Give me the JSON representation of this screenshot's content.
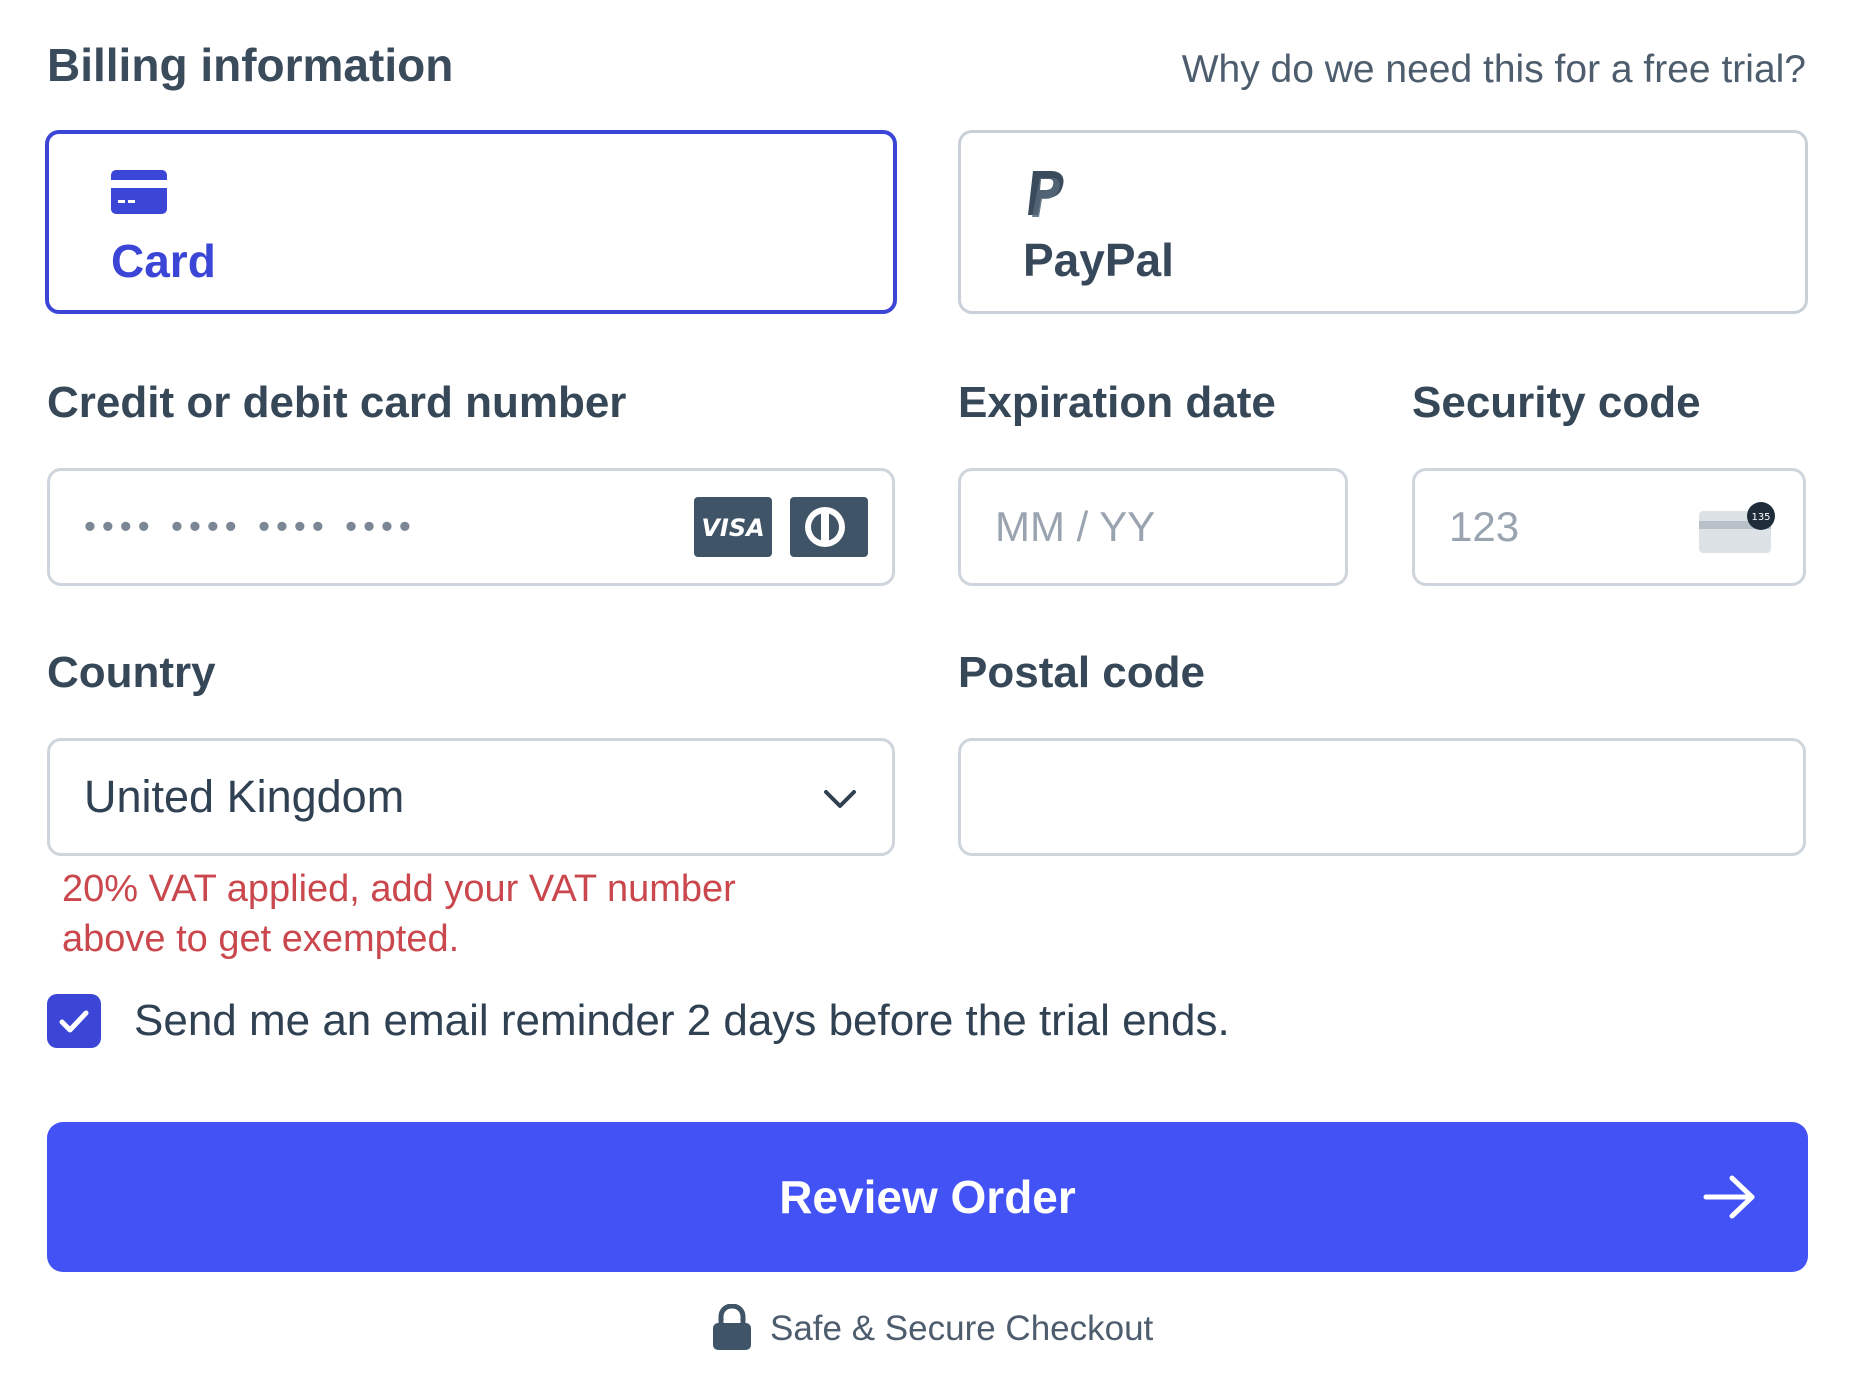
{
  "header": {
    "title": "Billing information",
    "why_link": "Why do we need this for a free trial?"
  },
  "payment_methods": [
    {
      "label": "Card",
      "icon": "credit-card-icon",
      "selected": true
    },
    {
      "label": "PayPal",
      "icon": "paypal-icon",
      "selected": false
    }
  ],
  "card_number": {
    "label": "Credit or debit card number",
    "placeholder": "•••• •••• •••• ••••",
    "brands": [
      "VISA",
      "diners-club-icon"
    ]
  },
  "expiration": {
    "label": "Expiration date",
    "placeholder": "MM / YY"
  },
  "security_code": {
    "label": "Security code",
    "placeholder": "123",
    "icon": "cvc-card-icon",
    "icon_badge": "135"
  },
  "country": {
    "label": "Country",
    "value": "United Kingdom"
  },
  "postal_code": {
    "label": "Postal code",
    "value": ""
  },
  "vat_note": "20% VAT applied, add your VAT number above to get exempted.",
  "reminder": {
    "label": "Send me an email reminder 2 days before the trial ends.",
    "checked": true
  },
  "review_button": {
    "label": "Review Order"
  },
  "secure_note": "Safe & Secure Checkout",
  "colors": {
    "accent": "#3c46d6",
    "button": "#4352f5",
    "error": "#c9474d",
    "border": "#cfd5dc"
  }
}
